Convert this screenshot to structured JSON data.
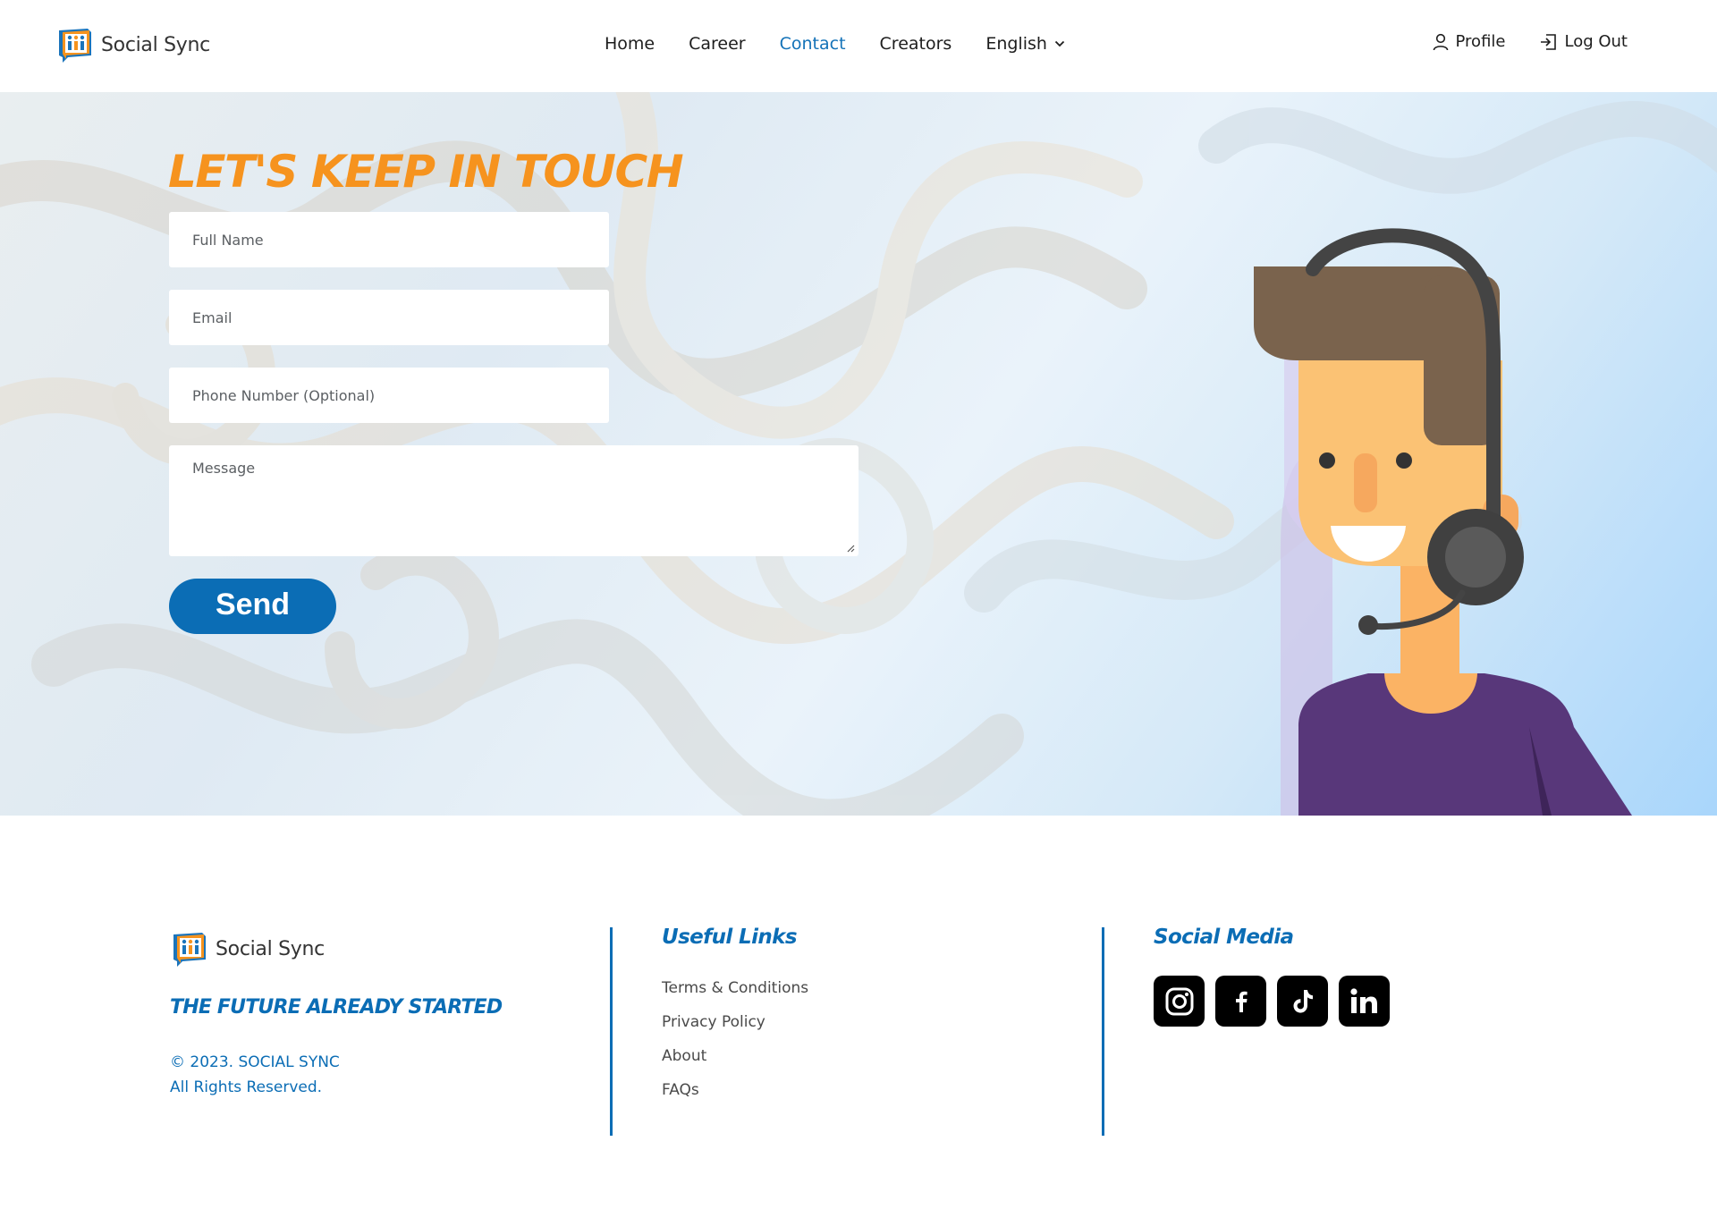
{
  "brand": {
    "name": "Social Sync"
  },
  "nav": {
    "items": [
      {
        "label": "Home"
      },
      {
        "label": "Career"
      },
      {
        "label": "Contact"
      },
      {
        "label": "Creators"
      }
    ],
    "active": "Contact",
    "language": "English"
  },
  "user": {
    "profile_label": "Profile",
    "logout_label": "Log Out"
  },
  "contact": {
    "title": "LET'S KEEP IN TOUCH",
    "full_name_placeholder": "Full Name",
    "email_placeholder": "Email",
    "phone_placeholder": "Phone Number (Optional)",
    "message_placeholder": "Message",
    "send_label": "Send"
  },
  "footer": {
    "tagline": "THE FUTURE ALREADY STARTED",
    "copyright_line1": "© 2023. SOCIAL SYNC",
    "copyright_line2": "All Rights Reserved.",
    "useful_links_title": "Useful Links",
    "links": [
      {
        "label": "Terms & Conditions"
      },
      {
        "label": "Privacy Policy"
      },
      {
        "label": "About"
      },
      {
        "label": "FAQs"
      }
    ],
    "social_title": "Social Media",
    "socials": [
      {
        "icon": "instagram-icon"
      },
      {
        "icon": "facebook-icon"
      },
      {
        "icon": "tiktok-icon"
      },
      {
        "icon": "linkedin-icon"
      }
    ]
  },
  "colors": {
    "accent_blue": "#0b6db5",
    "active_nav": "#1372b8",
    "title_orange": "#f6931e",
    "shirt_purple": "#58377a",
    "hair_brown": "#7a634d"
  }
}
